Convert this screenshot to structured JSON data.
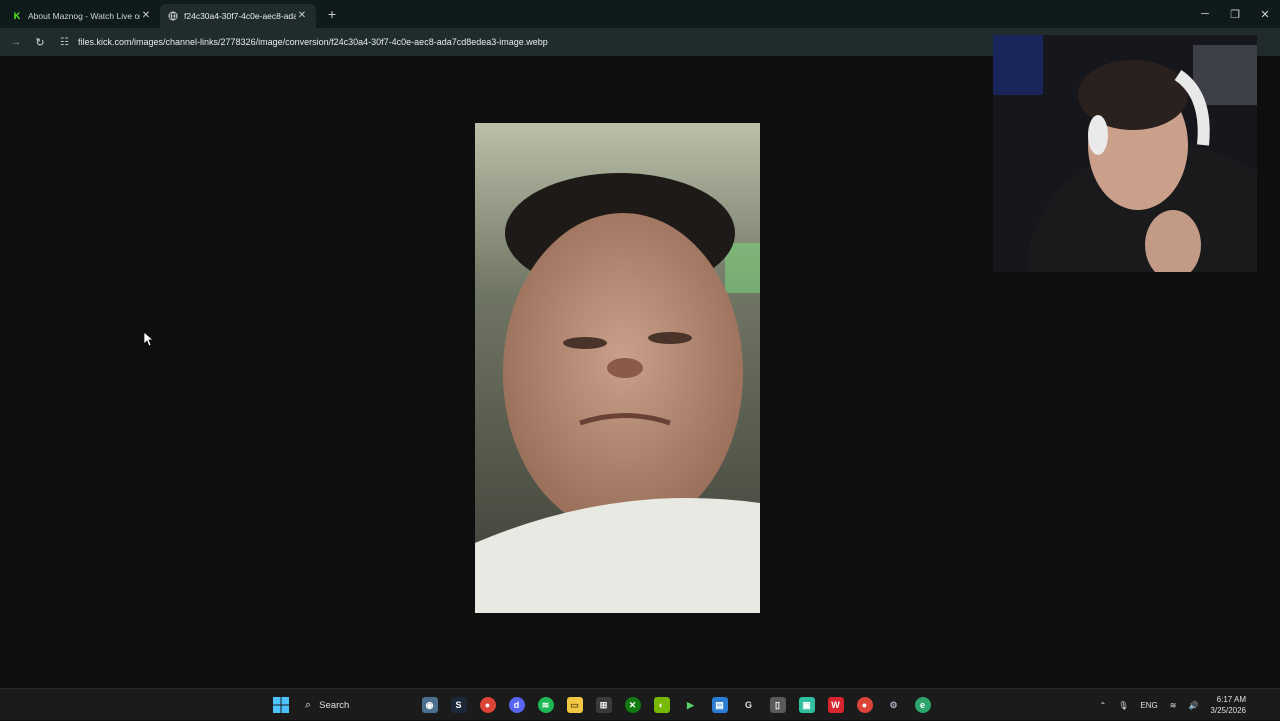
{
  "browser": {
    "tabs": [
      {
        "title": "About Maznog - Watch Live on",
        "favicon": "kick-favicon",
        "active": false
      },
      {
        "title": "f24c30a4-30f7-4c0e-aec8-ada7",
        "favicon": "globe-favicon",
        "active": true
      }
    ],
    "url": "files.kick.com/images/channel-links/2778326/image/conversion/f24c30a4-30f7-4c0e-aec8-ada7cd8edea3-image.webp"
  },
  "taskbar": {
    "search_label": "Search",
    "language": "ENG",
    "time": "6:17 AM",
    "date": "3/25/2026",
    "apps": [
      "camera-icon",
      "steam-icon",
      "chrome-icon",
      "discord-icon",
      "spotify-icon",
      "file-explorer-icon",
      "store-icon",
      "xbox-icon",
      "nvidia-icon",
      "play-icon",
      "notes-icon",
      "g-icon",
      "clipboard-icon",
      "app-icon",
      "wps-icon",
      "chrome-icon",
      "settings-icon",
      "edge-icon"
    ]
  },
  "colors": {
    "tabbar": "#0f1a1b",
    "toolbar": "#1f2b2c",
    "page_bg": "#0e0e0e",
    "kick_green": "#53fc18"
  }
}
